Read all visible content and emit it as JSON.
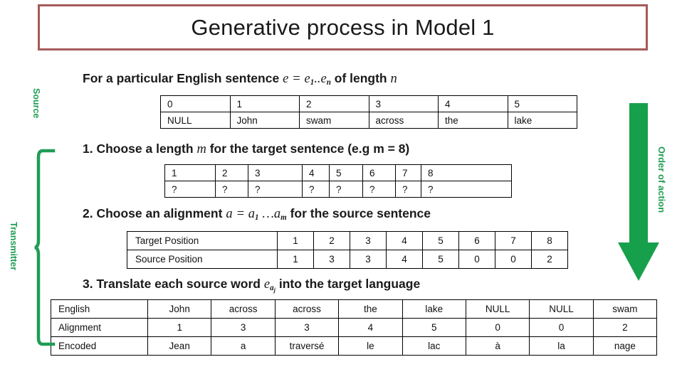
{
  "title": {
    "text": "Generative process in Model 1",
    "border_color": "#a55a5a"
  },
  "accent": {
    "green": "#1f9d55",
    "brick": "#a55a5a"
  },
  "statements": {
    "intro_prefix": "For a particular English sentence",
    "intro_var_e": "e",
    "intro_eq": "=",
    "intro_seq_e1": "e",
    "intro_seq_sub1": "1",
    "intro_dots": "..",
    "intro_seq_en": "e",
    "intro_seq_subn": "n",
    "intro_suffix": "of length",
    "intro_var_n": "n",
    "step1_prefix": "1. Choose a length",
    "step1_var_m": "m",
    "step1_suffix": "for the target sentence (e.g m = 8)",
    "step2_prefix": "2. Choose an alignment",
    "step2_var_a": "a",
    "step2_eq": "=",
    "step2_a1": "a",
    "step2_sub1": "1",
    "step2_dots": "…",
    "step2_am": "a",
    "step2_subm": "m",
    "step2_suffix": "for the source sentence",
    "step3_prefix": "3. Translate each source word",
    "step3_var_e": "e",
    "step3_sub_a": "a",
    "step3_sub_j": "j",
    "step3_suffix": "into the target language"
  },
  "source_table": {
    "indices": [
      "0",
      "1",
      "2",
      "3",
      "4",
      "5"
    ],
    "words": [
      "NULL",
      "John",
      "swam",
      "across",
      "the",
      "lake"
    ]
  },
  "target_table": {
    "indices": [
      "1",
      "2",
      "3",
      "4",
      "5",
      "6",
      "7",
      "8"
    ],
    "values": [
      "?",
      "?",
      "?",
      "?",
      "?",
      "?",
      "?",
      "?"
    ]
  },
  "alignment_table": {
    "row_labels": [
      "Target Position",
      "Source Position"
    ],
    "target_positions": [
      "1",
      "2",
      "3",
      "4",
      "5",
      "6",
      "7",
      "8"
    ],
    "source_positions": [
      "1",
      "3",
      "3",
      "4",
      "5",
      "0",
      "0",
      "2"
    ]
  },
  "translation_table": {
    "row_labels": [
      "English",
      "Alignment",
      "Encoded"
    ],
    "english": [
      "John",
      "across",
      "across",
      "the",
      "lake",
      "NULL",
      "NULL",
      "swam"
    ],
    "alignment": [
      "1",
      "3",
      "3",
      "4",
      "5",
      "0",
      "0",
      "2"
    ],
    "encoded": [
      "Jean",
      "a",
      "traversé",
      "le",
      "lac",
      "à",
      "la",
      "nage"
    ]
  },
  "annotations": {
    "source_label": "Source",
    "transmitter_label": "Transmitter",
    "order_label": "Order of action"
  }
}
